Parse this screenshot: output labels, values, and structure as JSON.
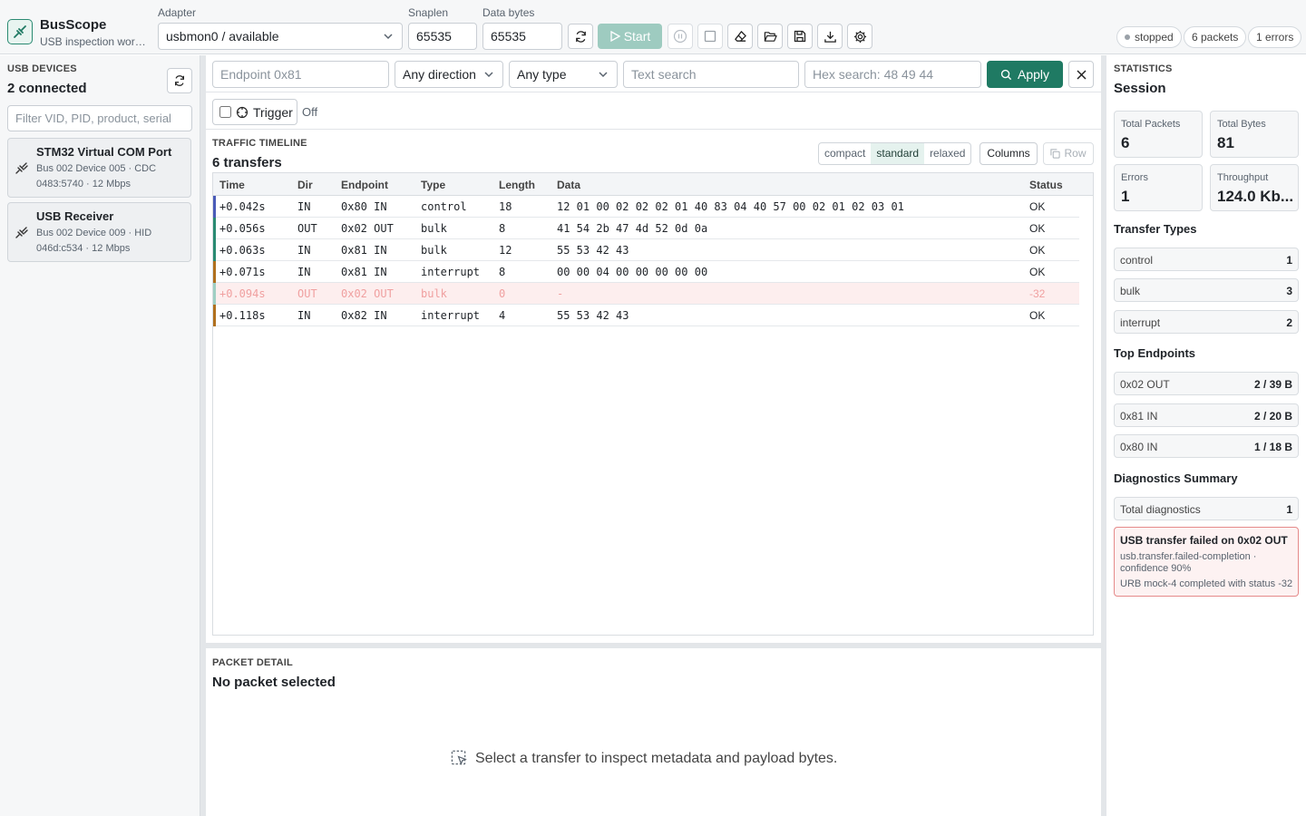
{
  "app": {
    "title": "BusScope",
    "subtitle": "USB inspection works..."
  },
  "toolbar": {
    "adapter_label": "Adapter",
    "adapter_value": "usbmon0 / available",
    "snaplen_label": "Snaplen",
    "snaplen_value": "65535",
    "databytes_label": "Data bytes",
    "databytes_value": "65535",
    "start_label": "Start",
    "status_pills": [
      "stopped",
      "6 packets",
      "1 errors"
    ]
  },
  "sidebar": {
    "section_label": "USB DEVICES",
    "count_title": "2 connected",
    "filter_placeholder": "Filter VID, PID, product, serial",
    "devices": [
      {
        "name": "STM32 Virtual COM Port",
        "line1": "Bus 002 Device 005 · CDC",
        "line2": "0483:5740 · 12 Mbps"
      },
      {
        "name": "USB Receiver",
        "line1": "Bus 002 Device 009 · HID",
        "line2": "046d:c534 · 12 Mbps"
      }
    ]
  },
  "filters": {
    "endpoint_placeholder": "Endpoint 0x81",
    "direction_value": "Any direction",
    "type_value": "Any type",
    "text_placeholder": "Text search",
    "hex_placeholder": "Hex search: 48 49 44",
    "apply_label": "Apply",
    "trigger_label": "Trigger",
    "trigger_state": "Off"
  },
  "timeline": {
    "section_label": "TRAFFIC TIMELINE",
    "title": "6 transfers",
    "density": [
      "compact",
      "standard",
      "relaxed"
    ],
    "columns_label": "Columns",
    "row_label": "Row",
    "headers": [
      "Time",
      "Dir",
      "Endpoint",
      "Type",
      "Length",
      "Data",
      "Status"
    ],
    "rows": [
      {
        "time": "+0.042s",
        "dir": "IN",
        "endpoint": "0x80 IN",
        "type": "control",
        "length": "18",
        "data": "12 01 00 02 02 02 01 40 83 04 40 57 00 02 01 02 03 01",
        "status": "OK",
        "color": "#4a5bb8",
        "error": false
      },
      {
        "time": "+0.056s",
        "dir": "OUT",
        "endpoint": "0x02 OUT",
        "type": "bulk",
        "length": "8",
        "data": "41 54 2b 47 4d 52 0d 0a",
        "status": "OK",
        "color": "#2a8a72",
        "error": false
      },
      {
        "time": "+0.063s",
        "dir": "IN",
        "endpoint": "0x81 IN",
        "type": "bulk",
        "length": "12",
        "data": "55 53 42 43",
        "status": "OK",
        "color": "#2a8a72",
        "error": false
      },
      {
        "time": "+0.071s",
        "dir": "IN",
        "endpoint": "0x81 IN",
        "type": "interrupt",
        "length": "8",
        "data": "00 00 04 00 00 00 00 00",
        "status": "OK",
        "color": "#b0701e",
        "error": false
      },
      {
        "time": "+0.094s",
        "dir": "OUT",
        "endpoint": "0x02 OUT",
        "type": "bulk",
        "length": "0",
        "data": "-",
        "status": "-32",
        "color": "#9fcfc3",
        "error": true
      },
      {
        "time": "+0.118s",
        "dir": "IN",
        "endpoint": "0x82 IN",
        "type": "interrupt",
        "length": "4",
        "data": "55 53 42 43",
        "status": "OK",
        "color": "#b0701e",
        "error": false
      }
    ]
  },
  "detail": {
    "section_label": "PACKET DETAIL",
    "title": "No packet selected",
    "empty_message": "Select a transfer to inspect metadata and payload bytes."
  },
  "stats": {
    "section_label": "STATISTICS",
    "title": "Session",
    "cards": [
      {
        "label": "Total Packets",
        "value": "6"
      },
      {
        "label": "Total Bytes",
        "value": "81"
      },
      {
        "label": "Errors",
        "value": "1"
      },
      {
        "label": "Throughput",
        "value": "124.0 Kb..."
      }
    ],
    "transfer_types_title": "Transfer Types",
    "transfer_types": [
      {
        "label": "control",
        "value": "1"
      },
      {
        "label": "bulk",
        "value": "3"
      },
      {
        "label": "interrupt",
        "value": "2"
      }
    ],
    "endpoints_title": "Top Endpoints",
    "endpoints": [
      {
        "label": "0x02 OUT",
        "value": "2 / 39 B"
      },
      {
        "label": "0x81 IN",
        "value": "2 / 20 B"
      },
      {
        "label": "0x80 IN",
        "value": "1 / 18 B"
      }
    ],
    "diag_title": "Diagnostics Summary",
    "diag_total_label": "Total diagnostics",
    "diag_total_value": "1",
    "diag": {
      "title": "USB transfer failed on 0x02 OUT",
      "line1": "usb.transfer.failed-completion ·",
      "line2": "confidence 90%",
      "line3": "URB mock-4 completed with status -32"
    }
  }
}
